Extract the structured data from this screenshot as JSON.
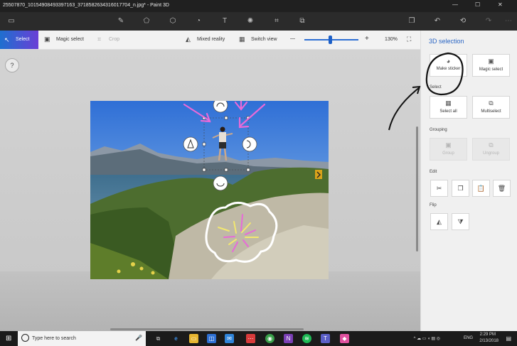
{
  "window": {
    "title": "25507870_10154908493397163_3718582634316017704_n.jpg* - Paint 3D",
    "minimize_icon": "—",
    "maximize_icon": "☐",
    "close_icon": "✕"
  },
  "ribbon": {
    "icons": [
      "menu-icon",
      "brushes-icon",
      "2d-shapes-icon",
      "3d-shapes-icon",
      "stickers-icon",
      "text-icon",
      "effects-icon",
      "canvas-icon",
      "remix3d-icon",
      "paste-icon",
      "undo-icon",
      "history-icon",
      "redo-icon",
      "more-icon"
    ]
  },
  "toolbar": {
    "select_label": "Select",
    "magic_select_label": "Magic select",
    "crop_label": "Crop",
    "mixed_reality_label": "Mixed reality",
    "switch_view_label": "Switch view",
    "zoom_minus": "—",
    "zoom_plus": "+",
    "zoom_level": "130%",
    "zoom_fraction": 0.47
  },
  "canvas": {
    "help_label": "?"
  },
  "panel": {
    "title": "3D selection",
    "make_sticker_label": "Make sticker",
    "magic_select_label": "Magic select",
    "select_section": "Select",
    "select_all_label": "Select all",
    "multiselect_label": "Multiselect",
    "grouping_section": "Grouping",
    "group_label": "Group",
    "ungroup_label": "Ungroup",
    "edit_section": "Edit",
    "flip_section": "Flip"
  },
  "taskbar": {
    "search_placeholder": "Type here to search",
    "language": "ENG",
    "time": "2:29 PM",
    "date": "2/13/2018"
  },
  "colors": {
    "accent": "#2b66c4",
    "annotation_pink": "#e86ad8",
    "annotation_black": "#111111"
  }
}
